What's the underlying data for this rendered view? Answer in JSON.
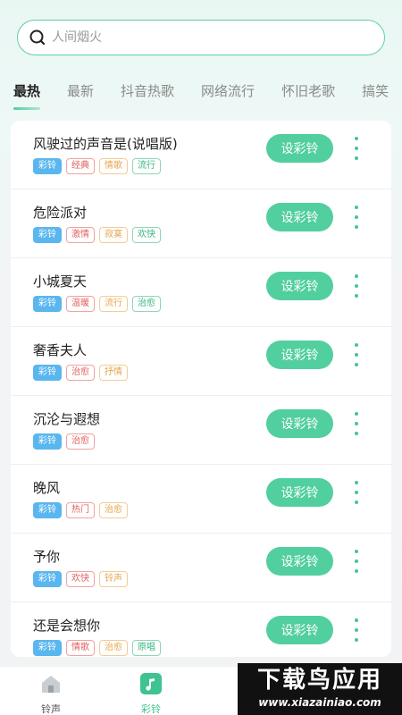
{
  "search": {
    "placeholder": "人间烟火"
  },
  "tabs": [
    {
      "label": "最热",
      "active": true
    },
    {
      "label": "最新",
      "active": false
    },
    {
      "label": "抖音热歌",
      "active": false
    },
    {
      "label": "网络流行",
      "active": false
    },
    {
      "label": "怀旧老歌",
      "active": false
    },
    {
      "label": "搞笑",
      "active": false
    }
  ],
  "songs": [
    {
      "title": "风驶过的声音是(说唱版)",
      "tags": [
        [
          "彩铃",
          "blue"
        ],
        [
          "经典",
          "red"
        ],
        [
          "情歌",
          "orange"
        ],
        [
          "流行",
          "green"
        ]
      ]
    },
    {
      "title": "危险派对",
      "tags": [
        [
          "彩铃",
          "blue"
        ],
        [
          "激情",
          "red"
        ],
        [
          "寂寞",
          "orange"
        ],
        [
          "欢快",
          "green"
        ]
      ]
    },
    {
      "title": "小城夏天",
      "tags": [
        [
          "彩铃",
          "blue"
        ],
        [
          "温暖",
          "red"
        ],
        [
          "流行",
          "orange"
        ],
        [
          "治愈",
          "green"
        ]
      ]
    },
    {
      "title": "奢香夫人",
      "tags": [
        [
          "彩铃",
          "blue"
        ],
        [
          "治愈",
          "red"
        ],
        [
          "抒情",
          "orange"
        ]
      ]
    },
    {
      "title": "沉沦与遐想",
      "tags": [
        [
          "彩铃",
          "blue"
        ],
        [
          "治愈",
          "red"
        ]
      ]
    },
    {
      "title": "晚风",
      "tags": [
        [
          "彩铃",
          "blue"
        ],
        [
          "热门",
          "red"
        ],
        [
          "治愈",
          "orange"
        ]
      ]
    },
    {
      "title": "予你",
      "tags": [
        [
          "彩铃",
          "blue"
        ],
        [
          "欢快",
          "red"
        ],
        [
          "铃声",
          "orange"
        ]
      ]
    },
    {
      "title": "还是会想你",
      "tags": [
        [
          "彩铃",
          "blue"
        ],
        [
          "情歌",
          "red"
        ],
        [
          "治愈",
          "orange"
        ],
        [
          "原唱",
          "green"
        ]
      ]
    }
  ],
  "button_label": "设彩铃",
  "bottom_nav": [
    {
      "label": "铃声",
      "icon": "home-icon",
      "active": false
    },
    {
      "label": "彩铃",
      "icon": "music-note-icon",
      "active": true
    }
  ],
  "watermark": {
    "line1": "下载鸟应用",
    "line2": "www.xiazainiao.com"
  },
  "colors": {
    "accent": "#52cf9e",
    "tag_blue": "#5ab6ee",
    "tag_red": "#e0605e",
    "tag_orange": "#e6a54c",
    "tag_green": "#35b67f"
  }
}
